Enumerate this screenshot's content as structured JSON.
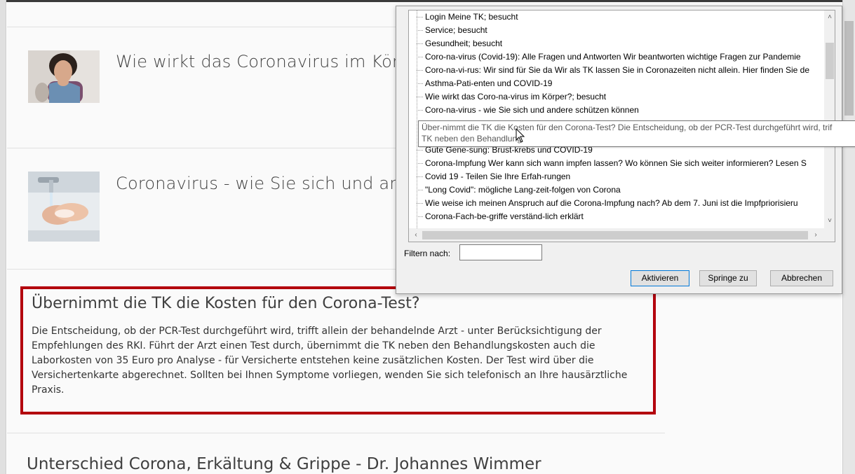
{
  "teasers": [
    {
      "title": "Wie wirkt das Coronavirus im Körpe",
      "image": "woman-coughing"
    },
    {
      "title": "Coronavirus - wie Sie sich und ande",
      "image": "hand-washing"
    }
  ],
  "article": {
    "title": "Übernimmt die TK die Kosten für den Corona-Test?",
    "body": "Die Entscheidung, ob der PCR-Test durchgeführt wird, trifft allein der behandelnde Arzt - unter Berücksichtigung der Empfehlungen des RKI. Führt der Arzt einen Test durch, übernimmt die TK neben den Behandlungskosten auch die Laborkosten von 35 Euro pro Analyse - für Versicherte entstehen keine zusätzlichen Kosten. Der Test wird über die Versichertenkarte abgerechnet. Sollten bei Ihnen Symptome vorliegen, wenden Sie sich telefonisch an Ihre hausärztliche Praxis.",
    "border_color": "#b3000d"
  },
  "next_article_title": "Unterschied Corona, Erkältung & Grippe - Dr. Johannes Wimmer",
  "dialog": {
    "tree_items": [
      "Login Meine TK; besucht",
      "Service; besucht",
      "Gesundheit; besucht",
      "Coro-na-virus (Covid-19): Alle Fragen und Antworten Wir beantworten wichtige Fragen zur Pandemie",
      "Coro-na-vi-rus: Wir sind für Sie da Wir als TK lassen Sie in Coronazeiten nicht allein. Hier finden Sie de",
      "Asthma-Pati-enten und COVID-19",
      "Wie wirkt das Coro-na-virus im Körper?; besucht",
      "Coro-na-virus - wie Sie sich und andere schützen können",
      "",
      "",
      "Gute Gene-sung: Brust-krebs und COVID-19",
      "Corona-Impfung Wer kann sich wann impfen lassen? Wo können Sie sich weiter informieren? Lesen S",
      "Covid 19 - Teilen Sie Ihre Erfah-rungen",
      "\"Long Covid\": mögliche Lang-zeit-folgen von Corona",
      "Wie weise ich meinen Anspruch auf die Corona-Impfung nach? Ab dem 7. Juni ist die Impfpriorisieru",
      "Corona-Fach-be-griffe verständ-lich erklärt"
    ],
    "tooltip_line1": "Über-nimmt die TK die Kosten für den Corona-Test? Die Entscheidung, ob der PCR-Test durchgeführt wird, trif",
    "tooltip_line2": "TK neben den Behandlung",
    "filter_label": "Filtern nach:",
    "filter_value": "",
    "buttons": {
      "activate": "Aktivieren",
      "jump": "Springe zu",
      "cancel": "Abbrechen"
    },
    "icons": {
      "scroll_up": "chevron-up-icon",
      "scroll_down": "chevron-down-icon",
      "scroll_left": "chevron-left-icon",
      "scroll_right": "chevron-right-icon",
      "cursor": "mouse-pointer-icon"
    }
  }
}
